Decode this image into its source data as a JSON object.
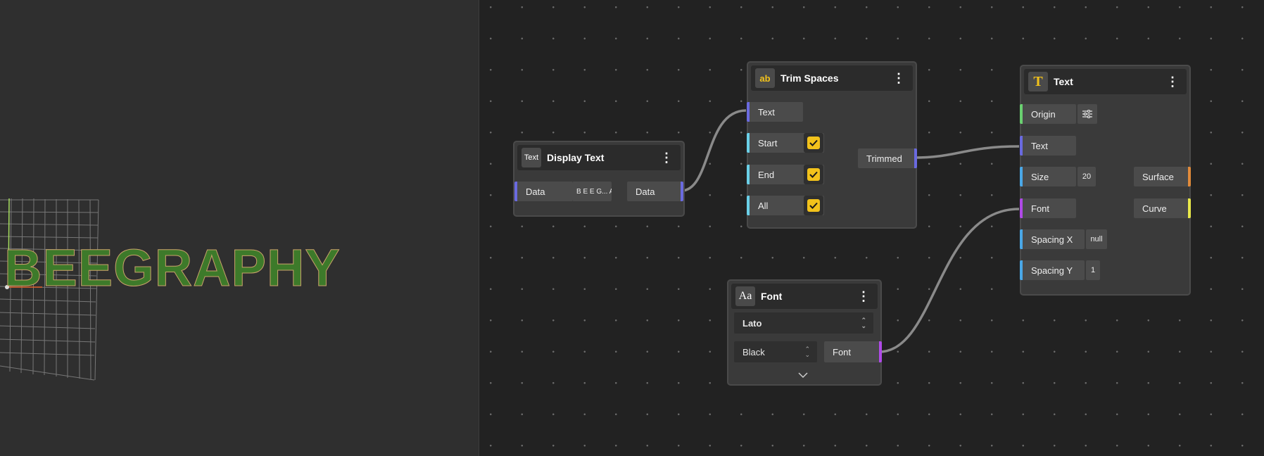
{
  "viewport": {
    "display_text": "BEEGRAPHY"
  },
  "nodes": {
    "display_text": {
      "icon_label": "Text",
      "title": "Display Text",
      "menu": "⋮",
      "input_label": "Data",
      "input_value": "B E E G... APH Y",
      "output_label": "Data"
    },
    "trim_spaces": {
      "icon_label": "ab",
      "title": "Trim Spaces",
      "menu": "⋮",
      "input_text": "Text",
      "start_label": "Start",
      "start_checked": true,
      "end_label": "End",
      "end_checked": true,
      "all_label": "All",
      "all_checked": true,
      "output_label": "Trimmed"
    },
    "font": {
      "icon_label": "Aa",
      "title": "Font",
      "menu": "⋮",
      "family_value": "Lato",
      "weight_value": "Black",
      "output_label": "Font"
    },
    "text": {
      "icon_label": "T",
      "title": "Text",
      "menu": "⋮",
      "origin_label": "Origin",
      "text_label": "Text",
      "size_label": "Size",
      "size_value": "20",
      "font_label": "Font",
      "spacing_x_label": "Spacing X",
      "spacing_x_value": "null",
      "spacing_y_label": "Spacing Y",
      "spacing_y_value": "1",
      "surface_label": "Surface",
      "curve_label": "Curve"
    }
  },
  "colors": {
    "accent_yellow": "#f2c21b",
    "wire": "#8a8a8a",
    "text_fill": "#3d7a2a",
    "port_data": "#6a6ae0"
  },
  "icons": [
    "text-icon",
    "trim-spaces-icon",
    "font-icon",
    "text-node-icon",
    "settings-sliders-icon",
    "kebab-menu-icon",
    "checkmark-icon",
    "chevron-down-icon"
  ]
}
